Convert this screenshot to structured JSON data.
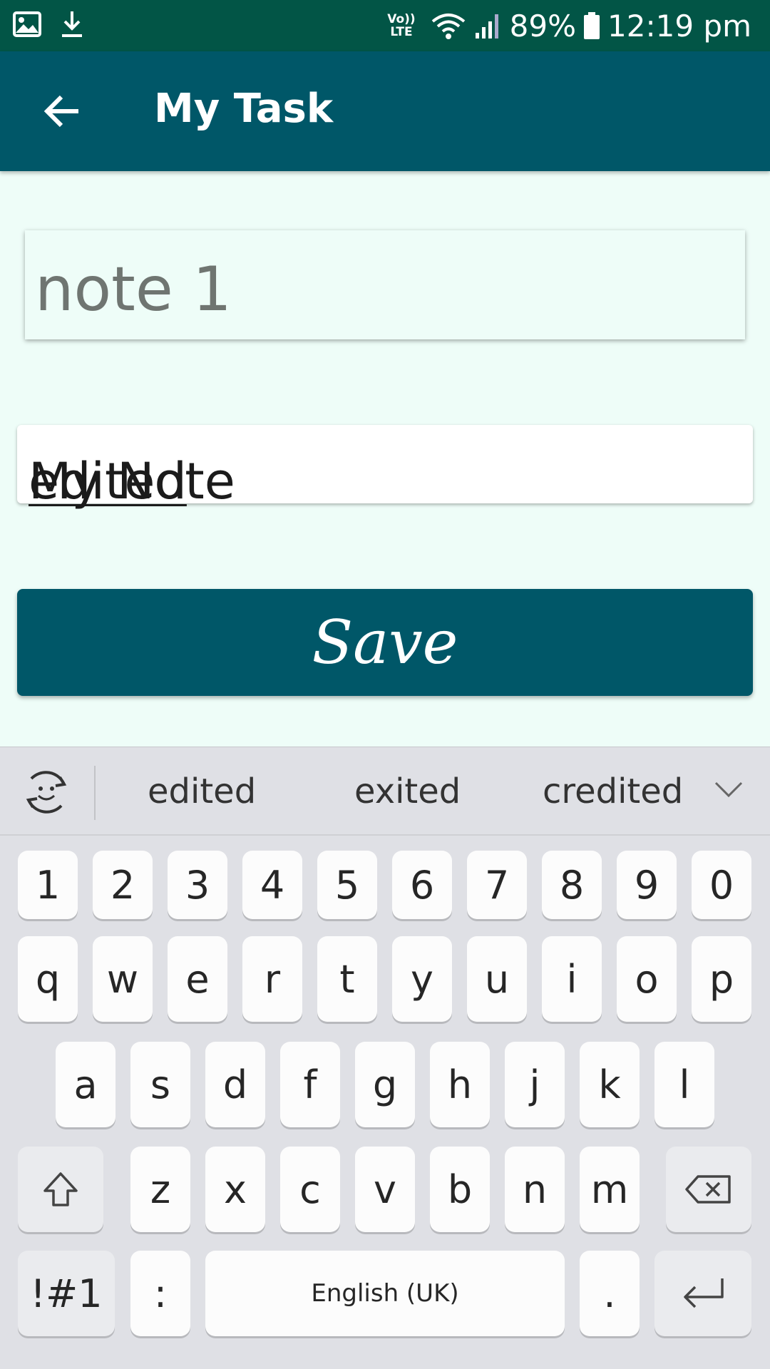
{
  "status_bar": {
    "icons_left": [
      "image-icon",
      "download-icon"
    ],
    "network": "VoLTE",
    "battery": "89%",
    "time": "12:19 pm"
  },
  "app_bar": {
    "title": "My Task",
    "back_icon": "arrow-back-icon"
  },
  "form": {
    "title_field_value": "note 1",
    "note_field_value_start": "My Note ",
    "note_field_value_word": "edited",
    "save_label": "Save"
  },
  "keyboard": {
    "suggestions": [
      "edited",
      "exited",
      "credited"
    ],
    "row_numbers": [
      "1",
      "2",
      "3",
      "4",
      "5",
      "6",
      "7",
      "8",
      "9",
      "0"
    ],
    "row_top": [
      "q",
      "w",
      "e",
      "r",
      "t",
      "y",
      "u",
      "i",
      "o",
      "p"
    ],
    "row_mid": [
      "a",
      "s",
      "d",
      "f",
      "g",
      "h",
      "j",
      "k",
      "l"
    ],
    "row_bottom": [
      "z",
      "x",
      "c",
      "v",
      "b",
      "n",
      "m"
    ],
    "symbols_label": "!#1",
    "colon_label": ":",
    "space_label": "English (UK)",
    "period_label": "."
  },
  "colors": {
    "status_bar": "#025546",
    "app_bar": "#005768",
    "background": "#eefdf8"
  }
}
